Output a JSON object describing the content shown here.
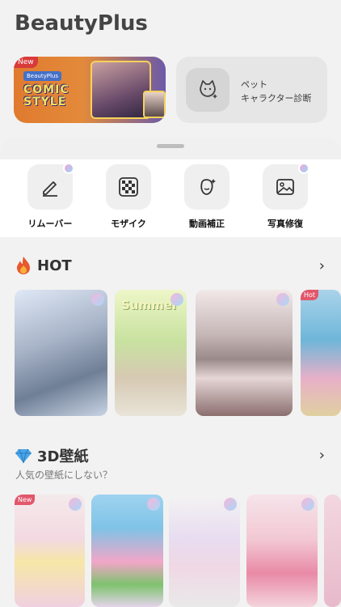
{
  "app": {
    "title": "BeautyPlus"
  },
  "banner": {
    "new_tag": "New",
    "brand": "BeautyPlus",
    "headline_line1": "COMIC",
    "headline_line2": "STYLE"
  },
  "pet_card": {
    "label": "ペット\nキャラクター診断",
    "icon": "cat-sparkle-icon"
  },
  "tools": [
    {
      "label": "リムーバー",
      "icon": "eraser-pen-icon",
      "badge": true
    },
    {
      "label": "モザイク",
      "icon": "mosaic-grid-icon",
      "badge": false
    },
    {
      "label": "動画補正",
      "icon": "face-sparkle-icon",
      "badge": false
    },
    {
      "label": "写真修復",
      "icon": "image-restore-icon",
      "badge": true
    }
  ],
  "hot": {
    "title": "HOT",
    "icon": "fire-icon",
    "items": [
      {
        "caption": ""
      },
      {
        "caption": "Summer"
      },
      {
        "caption": ""
      },
      {
        "caption": "Hot"
      }
    ]
  },
  "wallpaper": {
    "title": "3D壁紙",
    "icon": "diamond-icon",
    "subtitle": "人気の壁紙にしない？",
    "new_tag": "New"
  },
  "colors": {
    "accent_pink": "#e2576b",
    "tool_bg": "#efefef",
    "overlay": "#f2f2f2"
  }
}
